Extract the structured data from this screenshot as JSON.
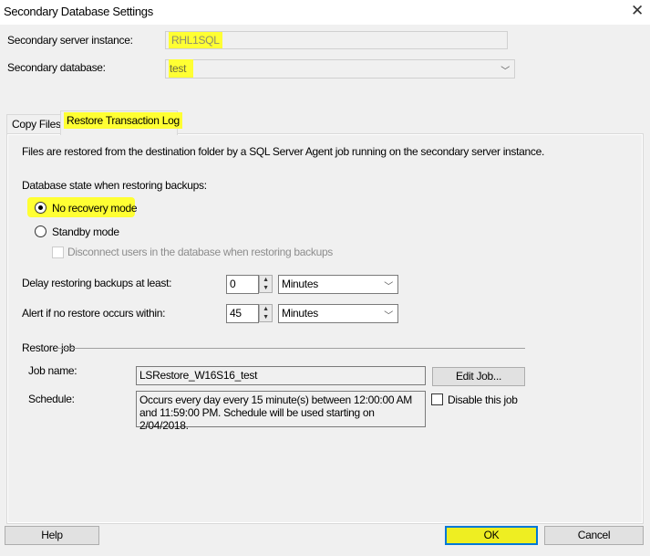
{
  "window": {
    "title": "Secondary Database Settings",
    "close_icon": "close-icon"
  },
  "server": {
    "label": "Secondary server instance:",
    "value": "RHL1SQL"
  },
  "database": {
    "label": "Secondary database:",
    "value": "test"
  },
  "tabs": [
    {
      "label": "Copy Files",
      "active": false
    },
    {
      "label": "Restore Transaction Log",
      "active": true
    }
  ],
  "restore": {
    "description": "Files are restored from the destination folder by a SQL Server Agent job running on the secondary server instance.",
    "state_label": "Database state when restoring backups:",
    "no_recovery": {
      "label": "No recovery mode",
      "selected": true
    },
    "standby": {
      "label": "Standby mode",
      "selected": false
    },
    "disconnect": {
      "label": "Disconnect users in the database when restoring backups",
      "checked": false,
      "enabled": false
    },
    "delay": {
      "label": "Delay restoring backups at least:",
      "value": "0",
      "unit": "Minutes"
    },
    "alert": {
      "label": "Alert if no restore occurs within:",
      "value": "45",
      "unit": "Minutes"
    },
    "job": {
      "group_label": "Restore job",
      "name_label": "Job name:",
      "name": "LSRestore_W16S16_test",
      "edit_label": "Edit Job...",
      "schedule_label": "Schedule:",
      "schedule": "Occurs every day every 15 minute(s) between 12:00:00 AM and 11:59:00 PM. Schedule will be used starting on 2/04/2018.",
      "disable_label": "Disable this job",
      "disable_checked": false
    }
  },
  "buttons": {
    "help": "Help",
    "ok": "OK",
    "cancel": "Cancel"
  },
  "colors": {
    "highlight": "#ffff33",
    "ok_border": "#0078d7"
  }
}
